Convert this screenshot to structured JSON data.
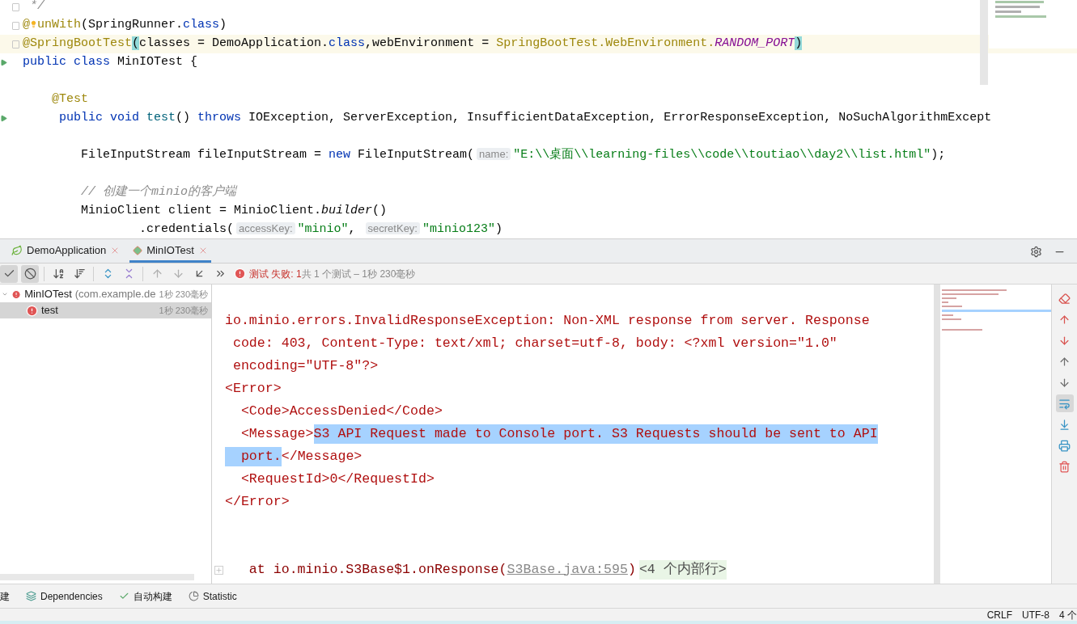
{
  "editor": {
    "lines": [
      {
        "current": false,
        "tokens": [
          {
            "text": " */",
            "kind": "comment"
          }
        ]
      },
      {
        "current": false,
        "tokens": [
          {
            "text": "@",
            "kind": "annotation"
          },
          {
            "kind": "bulb"
          },
          {
            "text": "unWith",
            "kind": "annotation"
          },
          {
            "text": "(SpringRunner.",
            "kind": "plain"
          },
          {
            "text": "class",
            "kind": "keyword"
          },
          {
            "text": ")",
            "kind": "plain"
          }
        ]
      },
      {
        "current": true,
        "tokens": [
          {
            "text": "@SpringBootTest",
            "kind": "annotation"
          },
          {
            "text": "(",
            "kind": "match"
          },
          {
            "text": "classes = DemoApplication.",
            "kind": "plain"
          },
          {
            "text": "class",
            "kind": "keyword"
          },
          {
            "text": ",webEnvironment = ",
            "kind": "plain"
          },
          {
            "text": "SpringBootTest.WebEnvironment.",
            "kind": "annotation"
          },
          {
            "text": "RANDOM_PORT",
            "kind": "constant"
          },
          {
            "text": ")",
            "kind": "match"
          }
        ]
      },
      {
        "current": false,
        "tokens": [
          {
            "text": "public class ",
            "kind": "keyword"
          },
          {
            "text": "MinIOTest {",
            "kind": "plain"
          }
        ]
      },
      {
        "current": false
      },
      {
        "current": false,
        "tokens": [
          {
            "text": "    @Test",
            "kind": "annotation"
          }
        ]
      },
      {
        "current": false,
        "tokens": [
          {
            "text": "     public void ",
            "kind": "keyword"
          },
          {
            "text": "test",
            "kind": "method"
          },
          {
            "text": "() ",
            "kind": "plain"
          },
          {
            "text": "throws ",
            "kind": "keyword"
          },
          {
            "text": "IOException, ServerException, InsufficientDataException, ErrorResponseException, NoSuchAlgorithmExcept",
            "kind": "plain"
          }
        ]
      },
      {
        "current": false
      },
      {
        "current": false,
        "tokens": [
          {
            "text": "        FileInputStream fileInputStream = ",
            "kind": "plain"
          },
          {
            "text": "new ",
            "kind": "keyword"
          },
          {
            "text": "FileInputStream(",
            "kind": "plain"
          },
          {
            "text": "name:",
            "kind": "hint"
          },
          {
            "text": "\"E:\\\\桌面\\\\learning-files\\\\code\\\\toutiao\\\\day2\\\\list.html\"",
            "kind": "string"
          },
          {
            "text": ");",
            "kind": "plain"
          }
        ]
      },
      {
        "current": false
      },
      {
        "current": false,
        "tokens": [
          {
            "text": "        // 创建一个minio的客户端",
            "kind": "comment"
          }
        ]
      },
      {
        "current": false,
        "tokens": [
          {
            "text": "        MinioClient client = MinioClient.",
            "kind": "plain"
          },
          {
            "text": "builder",
            "kind": "static"
          },
          {
            "text": "()",
            "kind": "plain"
          }
        ]
      },
      {
        "current": false,
        "tokens": [
          {
            "text": "                .credentials(",
            "kind": "plain"
          },
          {
            "text": "accessKey:",
            "kind": "hint"
          },
          {
            "text": "\"minio\"",
            "kind": "string"
          },
          {
            "text": ", ",
            "kind": "plain"
          },
          {
            "text": "secretKey:",
            "kind": "hint"
          },
          {
            "text": "\"minio123\"",
            "kind": "string"
          },
          {
            "text": ")",
            "kind": "plain"
          }
        ]
      }
    ]
  },
  "tabs": [
    {
      "label": "DemoApplication",
      "selected": false
    },
    {
      "label": "MinIOTest",
      "selected": true
    }
  ],
  "toolbar": [
    {
      "pressed": true
    },
    {
      "pressed": true
    },
    {
      "pressed": false
    },
    {
      "pressed": false
    },
    {
      "pressed": false
    },
    {
      "pressed": false
    },
    {
      "pressed": false
    },
    {
      "pressed": false
    },
    {
      "pressed": false
    },
    {
      "pressed": false
    }
  ],
  "status": {
    "failed": "测试 失败: 1",
    "summary": "共 1 个测试 – 1秒 230毫秒"
  },
  "tree": [
    {
      "name": "MinIOTest",
      "detail": "(com.example.de",
      "time": "1秒 230毫秒",
      "failed": true,
      "expanded": true,
      "selected": false,
      "children": [
        {
          "name": "test",
          "time": "1秒 230毫秒",
          "failed": true,
          "selected": true
        }
      ]
    }
  ],
  "console": {
    "lines": [
      [
        {
          "text": "io.minio.errors.InvalidResponseException: Non-XML response from server. Response",
          "selected": false
        }
      ],
      [
        {
          "text": " code: 403, Content-Type: text/xml; charset=utf-8, body: <?xml version=\"1.0\"",
          "selected": false
        }
      ],
      [
        {
          "text": " encoding=\"UTF-8\"?>",
          "selected": false
        }
      ],
      [
        {
          "text": "<Error>",
          "selected": false
        }
      ],
      [
        {
          "text": "  <Code>AccessDenied</Code>",
          "selected": false
        }
      ],
      [
        {
          "text": "  <Message>",
          "selected": false
        },
        {
          "text": "S3 API Request made to Console port. S3 Requests should be sent to API",
          "selected": true
        }
      ],
      [
        {
          "text": "  port.",
          "selected": true
        },
        {
          "text": "</Message>",
          "selected": false
        }
      ],
      [
        {
          "text": "  <RequestId>0</RequestId>",
          "selected": false
        }
      ],
      [
        {
          "text": "</Error>",
          "selected": false
        }
      ]
    ],
    "stack": {
      "prefix": "   at io.minio.S3Base$1.onResponse(",
      "link": "S3Base.java:595",
      "suffix": ")",
      "folded": "<4 个内部行>"
    }
  },
  "side_actions": [
    {
      "pressed": false
    },
    {
      "pressed": false
    },
    {
      "pressed": false
    },
    {
      "pressed": false
    },
    {
      "pressed": false
    },
    {
      "pressed": true
    },
    {
      "pressed": false
    },
    {
      "pressed": false
    },
    {
      "pressed": false
    }
  ],
  "bottom_tools": [
    "建",
    "Dependencies",
    "自动构建",
    "Statistic"
  ],
  "status_bar": [
    "CRLF",
    "UTF-8",
    "4 个"
  ]
}
